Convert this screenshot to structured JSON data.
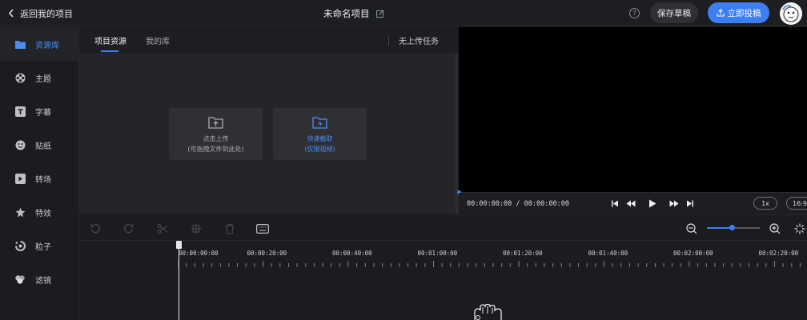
{
  "header": {
    "back_label": "返回我的项目",
    "project_title": "未命名项目",
    "help_symbol": "?",
    "save_draft_label": "保存草稿",
    "publish_label": "立即投稿"
  },
  "sidebar": {
    "items": [
      {
        "label": "资源库",
        "icon": "folder-icon",
        "active": true
      },
      {
        "label": "主题",
        "icon": "theme-icon",
        "active": false
      },
      {
        "label": "字幕",
        "icon": "subtitle-icon",
        "active": false
      },
      {
        "label": "贴纸",
        "icon": "sticker-icon",
        "active": false
      },
      {
        "label": "转场",
        "icon": "transition-icon",
        "active": false
      },
      {
        "label": "特效",
        "icon": "effects-icon",
        "active": false
      },
      {
        "label": "粒子",
        "icon": "particle-icon",
        "active": false
      },
      {
        "label": "滤镜",
        "icon": "filter-icon",
        "active": false
      }
    ]
  },
  "resource_panel": {
    "tabs": [
      "项目资源",
      "我的库"
    ],
    "upload_task_label": "无上传任务",
    "upload_card": {
      "line1": "点击上传",
      "line2": "(可拖拽文件到此处)"
    },
    "capture_card": {
      "line1": "快速截取",
      "line2": "(仅限视频)"
    }
  },
  "preview": {
    "timecode": "00:00:00:00 / 00:00:00:00",
    "speed_label": "1x",
    "ratio_label": "16:9"
  },
  "timeline": {
    "ruler_labels": [
      "00:00:00:00",
      "00:00:20:00",
      "00:00:40:00",
      "00:01:00:00",
      "00:01:20:00",
      "00:01:40:00",
      "00:02:00:00",
      "00:02:20:00"
    ],
    "zoom_fraction": 0.48
  },
  "colors": {
    "accent": "#3d7ef0",
    "background": "#161719",
    "panel": "#242528"
  }
}
